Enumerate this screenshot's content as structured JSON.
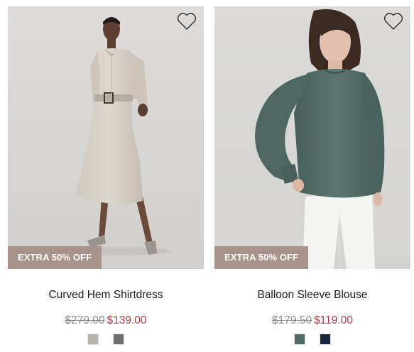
{
  "products": [
    {
      "badge": "EXTRA 50% OFF",
      "name": "Curved Hem Shirtdress",
      "original_price": "$279.00",
      "sale_price": "$139.00",
      "wishlist_icon": "heart-outline-icon",
      "swatch_colors": [
        "#b9b3ad",
        "#6e6e6e"
      ]
    },
    {
      "badge": "EXTRA 50% OFF",
      "name": "Balloon Sleeve Blouse",
      "original_price": "$179.50",
      "sale_price": "$119.00",
      "wishlist_icon": "heart-outline-icon",
      "swatch_colors": [
        "#4f6b66",
        "#1d2440"
      ]
    }
  ],
  "colors": {
    "badge_bg": "#a8928c",
    "sale_price": "#b53c46",
    "original_price": "#8c8c8c"
  }
}
